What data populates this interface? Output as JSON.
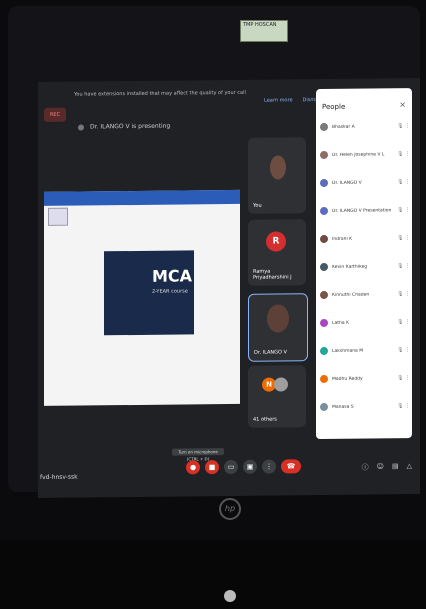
{
  "sticker": {
    "text": "TMP HOSCAN"
  },
  "banner": {
    "message": "You have extensions installed that may affect the quality of your call",
    "learn_more": "Learn more",
    "dismiss": "Dismiss"
  },
  "rec_badge": "REC",
  "presenting_text": "Dr. ILANGO V is presenting",
  "slide": {
    "title": "MCA",
    "subtitle": "2-YEAR course",
    "footer_left": "",
    "footer_right": ""
  },
  "tiles": {
    "you": {
      "label": "You"
    },
    "ramya": {
      "initial": "R",
      "name": "Ramya Priyadharshini J"
    },
    "ilango": {
      "name": "Dr. ILANGO V"
    },
    "others": {
      "initial": "N",
      "count_label": "41 others"
    }
  },
  "people": {
    "title": "People",
    "close": "×",
    "rows": [
      {
        "name": "Bhaskar A",
        "color": "#7b7b7b"
      },
      {
        "name": "Dr. Helen Josephine V L",
        "color": "#8d6e63"
      },
      {
        "name": "Dr. ILANGO V",
        "color": "#5c6bc0"
      },
      {
        "name": "Dr. ILANGO V Presentation",
        "color": "#5c6bc0"
      },
      {
        "name": "Indrani K",
        "color": "#6d4c41"
      },
      {
        "name": "Kevin Karthikeg",
        "color": "#455a64"
      },
      {
        "name": "Kinnuthi Chaden",
        "color": "#795548"
      },
      {
        "name": "Latha K",
        "color": "#ab47bc"
      },
      {
        "name": "Lakshmana M",
        "color": "#26a69a"
      },
      {
        "name": "Madhu Reddy",
        "color": "#ef6c00"
      },
      {
        "name": "Manasa S",
        "color": "#78909c"
      }
    ]
  },
  "mic_tooltip": "Turn on microphone (CTRL + D)",
  "meeting_code": "fvd-hnsv-ssk",
  "icons": {
    "mic": "mic-off-icon",
    "cam": "camera-off-icon",
    "cc": "captions-icon",
    "present": "present-icon",
    "more": "more-icon",
    "leave": "end-call-icon"
  }
}
